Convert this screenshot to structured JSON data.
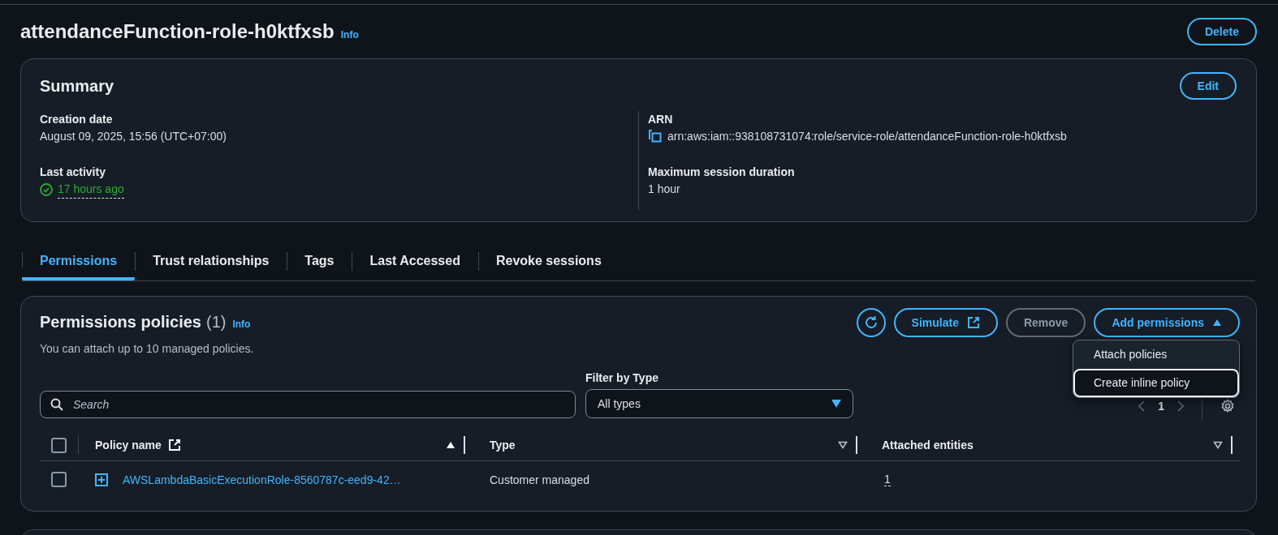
{
  "page": {
    "title": "attendanceFunction-role-h0ktfxsb",
    "info_link": "Info",
    "delete_button": "Delete"
  },
  "summary": {
    "title": "Summary",
    "edit_button": "Edit",
    "columns": [
      [
        {
          "label": "Creation date",
          "value": "August 09, 2025, 15:56 (UTC+07:00)",
          "kind": "text"
        },
        {
          "label": "Last activity",
          "value": "17 hours ago",
          "kind": "status"
        }
      ],
      [
        {
          "label": "ARN",
          "value": "arn:aws:iam::938108731074:role/service-role/attendanceFunction-role-h0ktfxsb",
          "kind": "copy"
        },
        {
          "label": "Maximum session duration",
          "value": "1 hour",
          "kind": "text"
        }
      ]
    ]
  },
  "tabs": [
    {
      "label": "Permissions",
      "selected": true
    },
    {
      "label": "Trust relationships",
      "selected": false
    },
    {
      "label": "Tags",
      "selected": false
    },
    {
      "label": "Last Accessed",
      "selected": false
    },
    {
      "label": "Revoke sessions",
      "selected": false
    }
  ],
  "permissions": {
    "title": "Permissions policies",
    "count": "(1)",
    "info_link": "Info",
    "description": "You can attach up to 10 managed policies.",
    "buttons": [
      {
        "label": "Simulate",
        "kind": "external",
        "disabled": false
      },
      {
        "label": "Remove",
        "kind": "plain",
        "disabled": true
      },
      {
        "label": "Add permissions",
        "kind": "dropdown",
        "disabled": false,
        "expanded": true
      }
    ],
    "menu": [
      {
        "label": "Attach policies",
        "selected": false
      },
      {
        "label": "Create inline policy",
        "selected": true
      }
    ],
    "search": {
      "placeholder": "Search"
    },
    "filter": {
      "label": "Filter by Type",
      "value": "All types"
    },
    "pagination": {
      "page": "1"
    },
    "table": {
      "select_all_checked": false,
      "columns": [
        {
          "label": "Policy name",
          "kind": "external",
          "sorted": true
        },
        {
          "label": "Type",
          "kind": "plain",
          "sorted": false
        },
        {
          "label": "Attached entities",
          "kind": "plain",
          "sorted": false
        }
      ],
      "rows": [
        {
          "checked": false,
          "cells": [
            "AWSLambdaBasicExecutionRole-8560787c-eed9-42…",
            "Customer managed",
            "1"
          ]
        }
      ]
    }
  }
}
